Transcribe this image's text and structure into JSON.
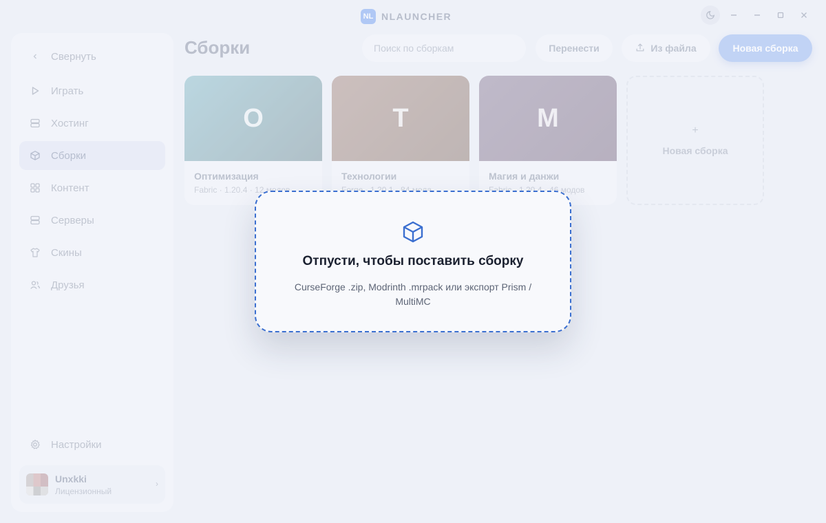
{
  "brand": {
    "logo_text": "NL",
    "name": "NLAUNCHER"
  },
  "sidebar": {
    "collapse_label": "Свернуть",
    "items": [
      {
        "label": "Играть",
        "icon": "play-icon"
      },
      {
        "label": "Хостинг",
        "icon": "server-icon"
      },
      {
        "label": "Сборки",
        "icon": "box-icon",
        "active": true
      },
      {
        "label": "Контент",
        "icon": "grid-icon"
      },
      {
        "label": "Серверы",
        "icon": "server-icon"
      },
      {
        "label": "Скины",
        "icon": "shirt-icon"
      },
      {
        "label": "Друзья",
        "icon": "users-icon"
      }
    ],
    "settings_label": "Настройки",
    "user": {
      "name": "Unxkki",
      "status": "Лицензионный"
    }
  },
  "header": {
    "title": "Сборки",
    "search_placeholder": "Поиск по сборкам",
    "transfer_label": "Перенести",
    "from_file_label": "Из файла",
    "new_pack_label": "Новая сборка"
  },
  "packs": [
    {
      "letter": "О",
      "title": "Оптимизация",
      "meta": "Fabric · 1.20.4 · 12 модов",
      "color_from": "#9fc9d3",
      "color_to": "#8fa6ad"
    },
    {
      "letter": "Т",
      "title": "Технологии",
      "meta": "Forge · 1.20.1 · 84 мода",
      "color_from": "#baa59e",
      "color_to": "#a69690"
    },
    {
      "letter": "М",
      "title": "Магия и данжи",
      "meta": "Fabric · 1.20.4 · 46 модов",
      "color_from": "#a79cb0",
      "color_to": "#9a8fa1"
    }
  ],
  "new_pack_card": {
    "plus": "+",
    "label": "Новая сборка"
  },
  "drop": {
    "title": "Отпусти, чтобы поставить сборку",
    "subtitle": "CurseForge .zip, Modrinth .mrpack или экспорт Prism / MultiMC",
    "accent": "#3b6fd0"
  }
}
